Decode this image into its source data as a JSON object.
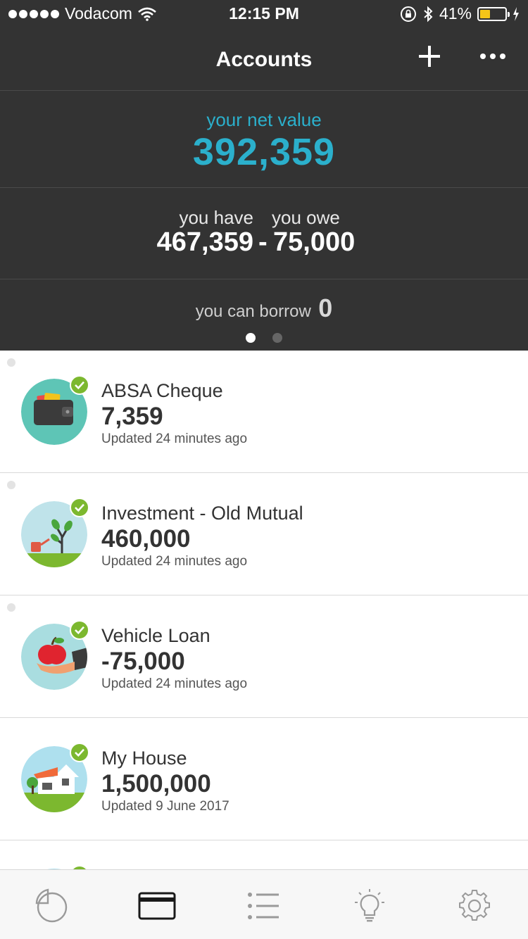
{
  "status_bar": {
    "carrier": "Vodacom",
    "time": "12:15 PM",
    "battery_percent": "41%",
    "battery_level": 0.41,
    "signal_icon": "signal-dots-icon",
    "wifi_icon": "wifi-icon",
    "rotation_lock_icon": "rotation-lock-icon",
    "bluetooth_icon": "bluetooth-icon",
    "charging_icon": "charging-bolt-icon"
  },
  "header": {
    "title": "Accounts",
    "add_icon": "plus-icon",
    "more_icon": "more-dots-icon"
  },
  "summary": {
    "net_label": "your net value",
    "net_value": "392,359",
    "have_label": "you have",
    "have_value": "467,359",
    "minus_sign": "-",
    "owe_label": "you owe",
    "owe_value": "75,000",
    "borrow_label": "you can borrow",
    "borrow_value": "0",
    "pages": 2,
    "active_page": 1
  },
  "accounts": [
    {
      "name": "ABSA Cheque",
      "amount": "7,359",
      "updated": "Updated 24 minutes ago",
      "icon": "wallet-icon"
    },
    {
      "name": "Investment - Old Mutual",
      "amount": "460,000",
      "updated": "Updated 24 minutes ago",
      "icon": "growing-tree-icon"
    },
    {
      "name": "Vehicle Loan",
      "amount": "-75,000",
      "updated": "Updated 24 minutes ago",
      "icon": "apple-in-hand-icon"
    },
    {
      "name": "My House",
      "amount": "1,500,000",
      "updated": "Updated 9 June 2017",
      "icon": "house-icon"
    }
  ],
  "tabbar": {
    "tabs": [
      "pie-chart-icon",
      "card-icon",
      "list-icon",
      "lightbulb-icon",
      "gear-icon"
    ],
    "active_tab": "card-icon"
  },
  "colors": {
    "header_bg": "#333333",
    "accent": "#2bb0cc",
    "check_green": "#7cb82f",
    "text_dark": "#333333"
  }
}
